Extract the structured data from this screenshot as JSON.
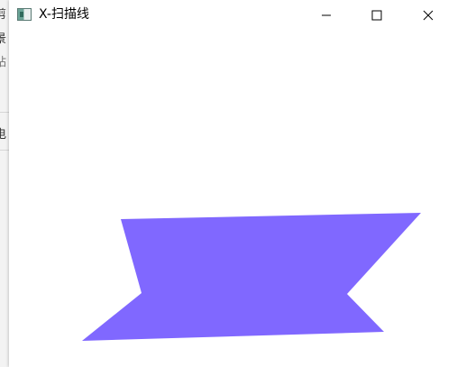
{
  "window": {
    "title": "X-扫描线",
    "icon": "app-window-icon",
    "controls": {
      "minimize_icon": "minimize-icon",
      "maximize_icon": "maximize-icon",
      "close_icon": "close-icon"
    }
  },
  "background_window": {
    "visible_glyphs": [
      "剪",
      "景",
      "钻",
      "电"
    ]
  },
  "canvas": {
    "background": "#ffffff",
    "polygon_fill": "#8068ff"
  }
}
